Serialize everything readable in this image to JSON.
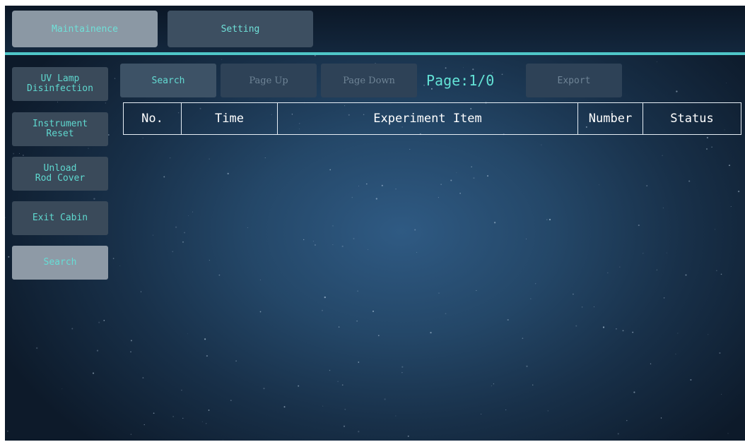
{
  "tabs": [
    {
      "label": "Maintainence",
      "active": true
    },
    {
      "label": "Setting",
      "active": false
    }
  ],
  "sidebar": {
    "items": [
      {
        "label": "UV Lamp\nDisinfection",
        "active": false
      },
      {
        "label": "Instrument\nReset",
        "active": false
      },
      {
        "label": "Unload\nRod Cover",
        "active": false
      },
      {
        "label": "Exit Cabin",
        "active": false
      },
      {
        "label": "Search",
        "active": true
      }
    ]
  },
  "toolbar": {
    "search_label": "Search",
    "page_up_label": "Page Up",
    "page_down_label": "Page Down",
    "page_indicator": "Page:1/0",
    "export_label": "Export"
  },
  "table": {
    "columns": [
      "No.",
      "Time",
      "Experiment Item",
      "Number",
      "Status"
    ],
    "rows": []
  },
  "colors": {
    "accent": "#4fc6c8",
    "text_accent": "#63e2d6",
    "background": "#1d3a57"
  }
}
